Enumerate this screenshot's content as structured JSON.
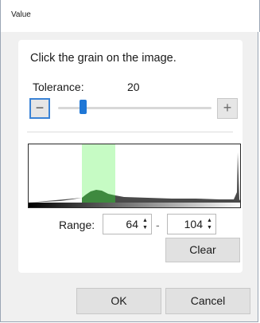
{
  "window": {
    "title": "Value"
  },
  "panel": {
    "instruction": "Click the grain on the image.",
    "tolerance": {
      "label": "Tolerance:",
      "value": "20",
      "minus_symbol": "−",
      "plus_symbol": "+"
    },
    "range": {
      "label": "Range:",
      "low": "64",
      "high": "104",
      "separator": "-",
      "up_arrow": "▲",
      "down_arrow": "▼"
    },
    "clear_label": "Clear"
  },
  "histogram": {
    "selection": {
      "low": 64,
      "high": 104
    },
    "colors": {
      "selection": "#c6fbc4",
      "curve": "#3f8a3f",
      "curve_outside": "#4a4a4a"
    }
  },
  "footer": {
    "ok_label": "OK",
    "cancel_label": "Cancel"
  },
  "colors": {
    "accent": "#1f77d6"
  }
}
